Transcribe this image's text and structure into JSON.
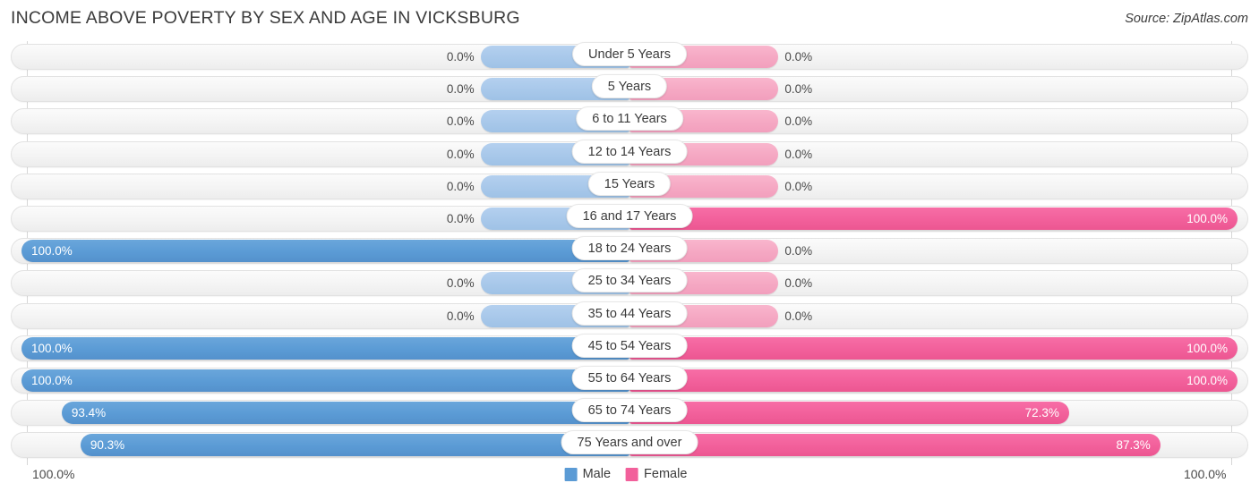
{
  "header": {
    "title": "INCOME ABOVE POVERTY BY SEX AND AGE IN VICKSBURG",
    "source": "Source: ZipAtlas.com"
  },
  "legend": {
    "male_label": "Male",
    "female_label": "Female",
    "male_color": "#5b9bd5",
    "female_color": "#f2609b"
  },
  "axis": {
    "left_max_label": "100.0%",
    "right_max_label": "100.0%"
  },
  "chart_data": {
    "type": "bar",
    "title": "INCOME ABOVE POVERTY BY SEX AND AGE IN VICKSBURG",
    "subtitle": "",
    "orientation": "horizontal-diverging",
    "xlabel": "",
    "ylabel": "",
    "xlim": [
      0,
      100
    ],
    "grid": false,
    "legend_position": "bottom-center",
    "categories": [
      "Under 5 Years",
      "5 Years",
      "6 to 11 Years",
      "12 to 14 Years",
      "15 Years",
      "16 and 17 Years",
      "18 to 24 Years",
      "25 to 34 Years",
      "35 to 44 Years",
      "45 to 54 Years",
      "55 to 64 Years",
      "65 to 74 Years",
      "75 Years and over"
    ],
    "series": [
      {
        "name": "Male",
        "color": "#5b9bd5",
        "values": [
          0.0,
          0.0,
          0.0,
          0.0,
          0.0,
          0.0,
          100.0,
          0.0,
          0.0,
          100.0,
          100.0,
          93.4,
          90.3
        ],
        "labels": [
          "0.0%",
          "0.0%",
          "0.0%",
          "0.0%",
          "0.0%",
          "0.0%",
          "100.0%",
          "0.0%",
          "0.0%",
          "100.0%",
          "100.0%",
          "93.4%",
          "90.3%"
        ]
      },
      {
        "name": "Female",
        "color": "#f2609b",
        "values": [
          0.0,
          0.0,
          0.0,
          0.0,
          0.0,
          0.0,
          100.0,
          0.0,
          0.0,
          100.0,
          100.0,
          72.3,
          87.3
        ],
        "labels": [
          "0.0%",
          "0.0%",
          "0.0%",
          "0.0%",
          "0.0%",
          "0.0%",
          "100.0%",
          "0.0%",
          "0.0%",
          "100.0%",
          "100.0%",
          "72.3%",
          "87.3%"
        ]
      }
    ],
    "female_values_note": "",
    "rows": [
      {
        "category": "Under 5 Years",
        "male": 0.0,
        "male_label": "0.0%",
        "female": 0.0,
        "female_label": "0.0%"
      },
      {
        "category": "5 Years",
        "male": 0.0,
        "male_label": "0.0%",
        "female": 0.0,
        "female_label": "0.0%"
      },
      {
        "category": "6 to 11 Years",
        "male": 0.0,
        "male_label": "0.0%",
        "female": 0.0,
        "female_label": "0.0%"
      },
      {
        "category": "12 to 14 Years",
        "male": 0.0,
        "male_label": "0.0%",
        "female": 0.0,
        "female_label": "0.0%"
      },
      {
        "category": "15 Years",
        "male": 0.0,
        "male_label": "0.0%",
        "female": 0.0,
        "female_label": "0.0%"
      },
      {
        "category": "16 and 17 Years",
        "male": 0.0,
        "male_label": "0.0%",
        "female": 100.0,
        "female_label": "100.0%"
      },
      {
        "category": "18 to 24 Years",
        "male": 100.0,
        "male_label": "100.0%",
        "female": 0.0,
        "female_label": "0.0%"
      },
      {
        "category": "25 to 34 Years",
        "male": 0.0,
        "male_label": "0.0%",
        "female": 0.0,
        "female_label": "0.0%"
      },
      {
        "category": "35 to 44 Years",
        "male": 0.0,
        "male_label": "0.0%",
        "female": 0.0,
        "female_label": "0.0%"
      },
      {
        "category": "45 to 54 Years",
        "male": 100.0,
        "male_label": "100.0%",
        "female": 100.0,
        "female_label": "100.0%"
      },
      {
        "category": "55 to 64 Years",
        "male": 100.0,
        "male_label": "100.0%",
        "female": 100.0,
        "female_label": "100.0%"
      },
      {
        "category": "65 to 74 Years",
        "male": 93.4,
        "male_label": "93.4%",
        "female": 72.3,
        "female_label": "72.3%"
      },
      {
        "category": "75 Years and over",
        "male": 90.3,
        "male_label": "90.3%",
        "female": 87.3,
        "female_label": "87.3%"
      }
    ]
  }
}
